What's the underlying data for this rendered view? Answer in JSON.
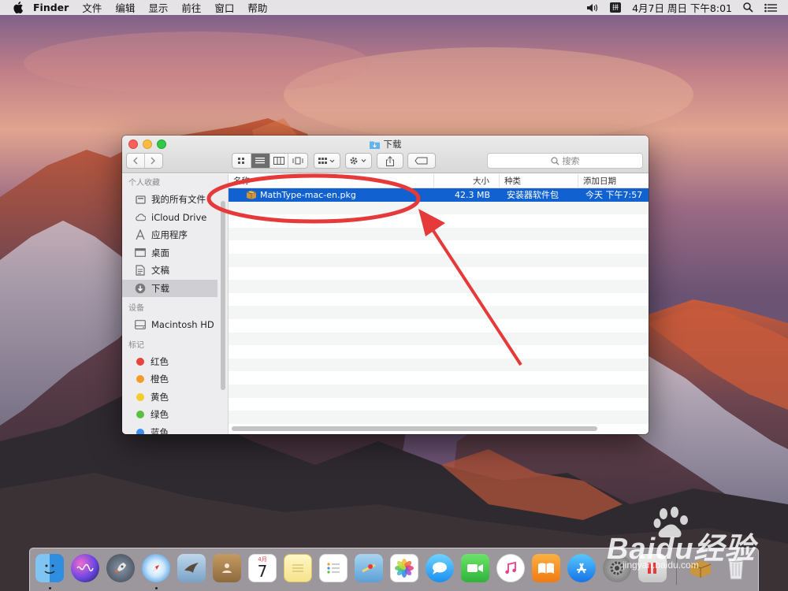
{
  "menubar": {
    "app_name": "Finder",
    "menus": [
      "文件",
      "编辑",
      "显示",
      "前往",
      "窗口",
      "帮助"
    ],
    "ime_label": "拼",
    "clock": "4月7日 周日 下午8:01"
  },
  "window": {
    "title": "下载",
    "search_placeholder": "搜索",
    "sidebar": {
      "favorites_header": "个人收藏",
      "favorites": [
        "我的所有文件",
        "iCloud Drive",
        "应用程序",
        "桌面",
        "文稿",
        "下载"
      ],
      "devices_header": "设备",
      "devices": [
        "Macintosh HD"
      ],
      "tags_header": "标记",
      "tags": [
        {
          "label": "红色",
          "color": "#e9443b"
        },
        {
          "label": "橙色",
          "color": "#f39a27"
        },
        {
          "label": "黄色",
          "color": "#f4cc2c"
        },
        {
          "label": "绿色",
          "color": "#57c23f"
        },
        {
          "label": "蓝色",
          "color": "#3a8ff2"
        }
      ]
    },
    "columns": {
      "name": "名称",
      "size": "大小",
      "kind": "种类",
      "date_added": "添加日期"
    },
    "files": [
      {
        "name": "MathType-mac-en.pkg",
        "size": "42.3 MB",
        "kind": "安装器软件包",
        "date_added": "今天 下午7:57"
      }
    ]
  },
  "dock": {
    "calendar_day": "7",
    "calendar_month": "4月"
  },
  "watermark": {
    "brand": "Baidu经验",
    "url": "jingyan.baidu.com"
  },
  "colors": {
    "selection": "#1162d0",
    "annotation": "#e63a3a",
    "close": "#fc605c",
    "minimize": "#fdbc40",
    "zoom": "#34c84a"
  }
}
